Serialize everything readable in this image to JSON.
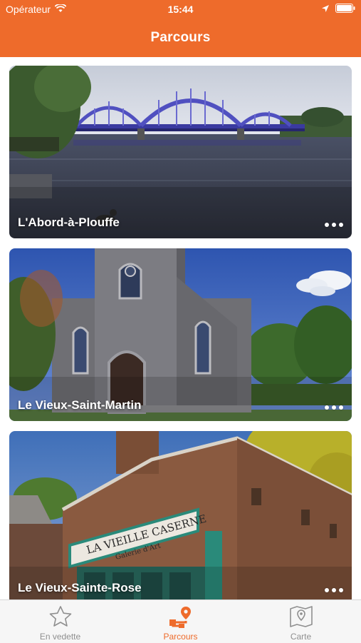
{
  "status_bar": {
    "carrier": "Opérateur",
    "time": "15:44"
  },
  "nav": {
    "title": "Parcours"
  },
  "cards": [
    {
      "title": "L'Abord-à-Plouffe"
    },
    {
      "title": "Le Vieux-Saint-Martin"
    },
    {
      "title": "Le Vieux-Sainte-Rose"
    }
  ],
  "tabs": [
    {
      "label": "En vedette",
      "icon": "star-icon",
      "active": false
    },
    {
      "label": "Parcours",
      "icon": "route-icon",
      "active": true
    },
    {
      "label": "Carte",
      "icon": "map-icon",
      "active": false
    }
  ],
  "colors": {
    "accent": "#EE6B2B",
    "tab_inactive": "#8f8f8f"
  }
}
